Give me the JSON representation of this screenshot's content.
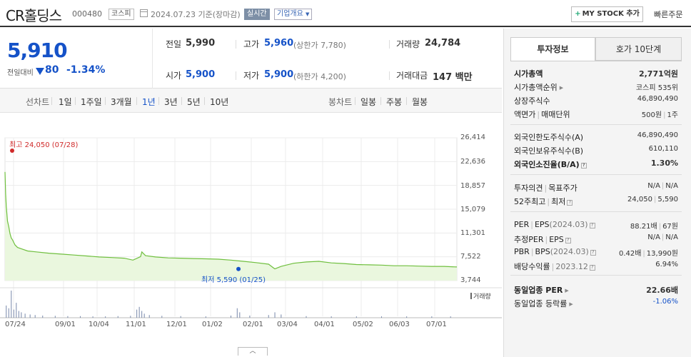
{
  "header": {
    "stock_name": "CR홀딩스",
    "stock_code": "000480",
    "market_badge": "코스피",
    "date_text": "2024.07.23  기준(장마감)",
    "realtime_badge": "실시간",
    "corp_overview_badge": "기업개요",
    "my_stock_button": "MY STOCK 추가",
    "quick_order_button": "빠른주문"
  },
  "summary": {
    "price": "5,910",
    "change_label": "전일대비",
    "change_amount": "80",
    "change_percent": "-1.34%",
    "stats": {
      "prev_close_label": "전일",
      "prev_close": "5,990",
      "high_label": "고가",
      "high": "5,960",
      "upper_limit": "(상한가 7,780)",
      "volume_label": "거래량",
      "volume": "24,784",
      "open_label": "시가",
      "open": "5,900",
      "low_label": "저가",
      "low": "5,900",
      "lower_limit": "(하한가 4,200)",
      "amount_label": "거래대금",
      "amount": "147 백만"
    }
  },
  "tabs": {
    "line_chart_label": "선차트",
    "periods": [
      "1일",
      "1주일",
      "3개월",
      "1년",
      "3년",
      "5년",
      "10년"
    ],
    "active_period": "1년",
    "candle_label": "봉차트",
    "candle_periods": [
      "일봉",
      "주봉",
      "월봉"
    ]
  },
  "chart_data": {
    "type": "area",
    "x_tick_labels": [
      "07/24",
      "09/01",
      "10/04",
      "11/01",
      "12/01",
      "01/02",
      "02/01",
      "03/04",
      "04/01",
      "05/02",
      "06/03",
      "07/01"
    ],
    "y_tick_labels": [
      "26,414",
      "22,636",
      "18,857",
      "15,079",
      "11,301",
      "7,522",
      "3,744"
    ],
    "ylim": [
      3744,
      26414
    ],
    "price_series": [
      [
        0,
        21000
      ],
      [
        0.5,
        17500
      ],
      [
        1,
        15500
      ],
      [
        2,
        13200
      ],
      [
        3,
        12300
      ],
      [
        4,
        11200
      ],
      [
        5,
        10500
      ],
      [
        6,
        10200
      ],
      [
        7,
        9800
      ],
      [
        8,
        9400
      ],
      [
        10,
        9000
      ],
      [
        13,
        8800
      ],
      [
        18,
        8450
      ],
      [
        25,
        8300
      ],
      [
        35,
        8100
      ],
      [
        45,
        7950
      ],
      [
        55,
        7800
      ],
      [
        65,
        7650
      ],
      [
        75,
        7500
      ],
      [
        85,
        7400
      ],
      [
        95,
        7300
      ],
      [
        102,
        7000
      ],
      [
        108,
        7550
      ],
      [
        109,
        8300
      ],
      [
        112,
        7700
      ],
      [
        120,
        7500
      ],
      [
        130,
        7350
      ],
      [
        140,
        7300
      ],
      [
        150,
        7250
      ],
      [
        160,
        7200
      ],
      [
        170,
        7150
      ],
      [
        180,
        7000
      ],
      [
        190,
        6800
      ],
      [
        200,
        6600
      ],
      [
        210,
        6350
      ],
      [
        215,
        5600
      ],
      [
        220,
        6000
      ],
      [
        230,
        6500
      ],
      [
        240,
        6700
      ],
      [
        250,
        6800
      ],
      [
        260,
        6550
      ],
      [
        270,
        6450
      ],
      [
        280,
        6300
      ],
      [
        290,
        6250
      ],
      [
        300,
        6200
      ],
      [
        310,
        6100
      ],
      [
        320,
        6100
      ],
      [
        330,
        6050
      ],
      [
        340,
        6000
      ],
      [
        350,
        6000
      ],
      [
        360,
        5910
      ]
    ],
    "x_length": 360,
    "high_marker": {
      "label": "최고 24,050 (07/28)",
      "x": 2,
      "y": 24050
    },
    "low_marker": {
      "label": "최저 5,590 (01/25)",
      "x": 186,
      "y": 5590
    },
    "volume_label": "거래량",
    "volume_series": [
      [
        1,
        0.45
      ],
      [
        3,
        0.35
      ],
      [
        5,
        1.0
      ],
      [
        7,
        0.3
      ],
      [
        9,
        0.55
      ],
      [
        11,
        0.25
      ],
      [
        13,
        0.2
      ],
      [
        16,
        0.15
      ],
      [
        20,
        0.12
      ],
      [
        24,
        0.1
      ],
      [
        30,
        0.08
      ],
      [
        40,
        0.07
      ],
      [
        50,
        0.06
      ],
      [
        60,
        0.06
      ],
      [
        70,
        0.05
      ],
      [
        80,
        0.05
      ],
      [
        90,
        0.06
      ],
      [
        100,
        0.07
      ],
      [
        105,
        0.3
      ],
      [
        107,
        0.4
      ],
      [
        109,
        0.25
      ],
      [
        111,
        0.15
      ],
      [
        115,
        0.1
      ],
      [
        125,
        0.07
      ],
      [
        140,
        0.06
      ],
      [
        160,
        0.05
      ],
      [
        180,
        0.08
      ],
      [
        185,
        0.35
      ],
      [
        187,
        0.2
      ],
      [
        195,
        0.08
      ],
      [
        210,
        0.1
      ],
      [
        215,
        0.2
      ],
      [
        220,
        0.12
      ],
      [
        240,
        0.06
      ],
      [
        260,
        0.05
      ],
      [
        280,
        0.05
      ],
      [
        300,
        0.05
      ],
      [
        320,
        0.05
      ],
      [
        340,
        0.05
      ],
      [
        355,
        0.05
      ]
    ]
  },
  "chart_toggle": "︿",
  "right_panel": {
    "tab_invest": "투자정보",
    "tab_orderbook": "호가 10단계",
    "sec1": {
      "market_cap_label": "시가총액",
      "market_cap": "2,771억원",
      "market_cap_rank_label": "시가총액순위",
      "market_cap_rank": "코스피  535위",
      "shares_label": "상장주식수",
      "shares": "46,890,490",
      "face_value_label": "액면가",
      "trade_unit_label": "매매단위",
      "face_value": "500원",
      "trade_unit": "1주"
    },
    "sec2": {
      "foreign_limit_label": "외국인한도주식수(A)",
      "foreign_limit": "46,890,490",
      "foreign_hold_label": "외국인보유주식수(B)",
      "foreign_hold": "610,110",
      "foreign_ratio_label": "외국인소진율(B/A)",
      "foreign_ratio": "1.30%"
    },
    "sec3": {
      "opinion_label": "투자의견",
      "target_label": "목표주가",
      "opinion": "N/A",
      "target": "N/A",
      "week52_label": "52주최고",
      "week52_low_label": "최저",
      "week52_high": "24,050",
      "week52_low": "5,590"
    },
    "sec4": {
      "per_label": "PER",
      "eps_label": "EPS",
      "eps_date": "(2024.03)",
      "per": "88.21배",
      "eps": "67원",
      "est_per_label": "추정PER",
      "est_eps_label": "EPS",
      "est_per": "N/A",
      "est_eps": "N/A",
      "pbr_label": "PBR",
      "bps_label": "BPS",
      "bps_date": "(2024.03)",
      "pbr": "0.42배",
      "bps": "13,990원",
      "div_label": "배당수익률",
      "div_date": "2023.12",
      "div": "6.94%"
    },
    "sec5": {
      "sector_per_label": "동일업종 PER",
      "sector_per": "22.66배",
      "sector_change_label": "동일업종 등락률",
      "sector_change": "-1.06%"
    }
  }
}
